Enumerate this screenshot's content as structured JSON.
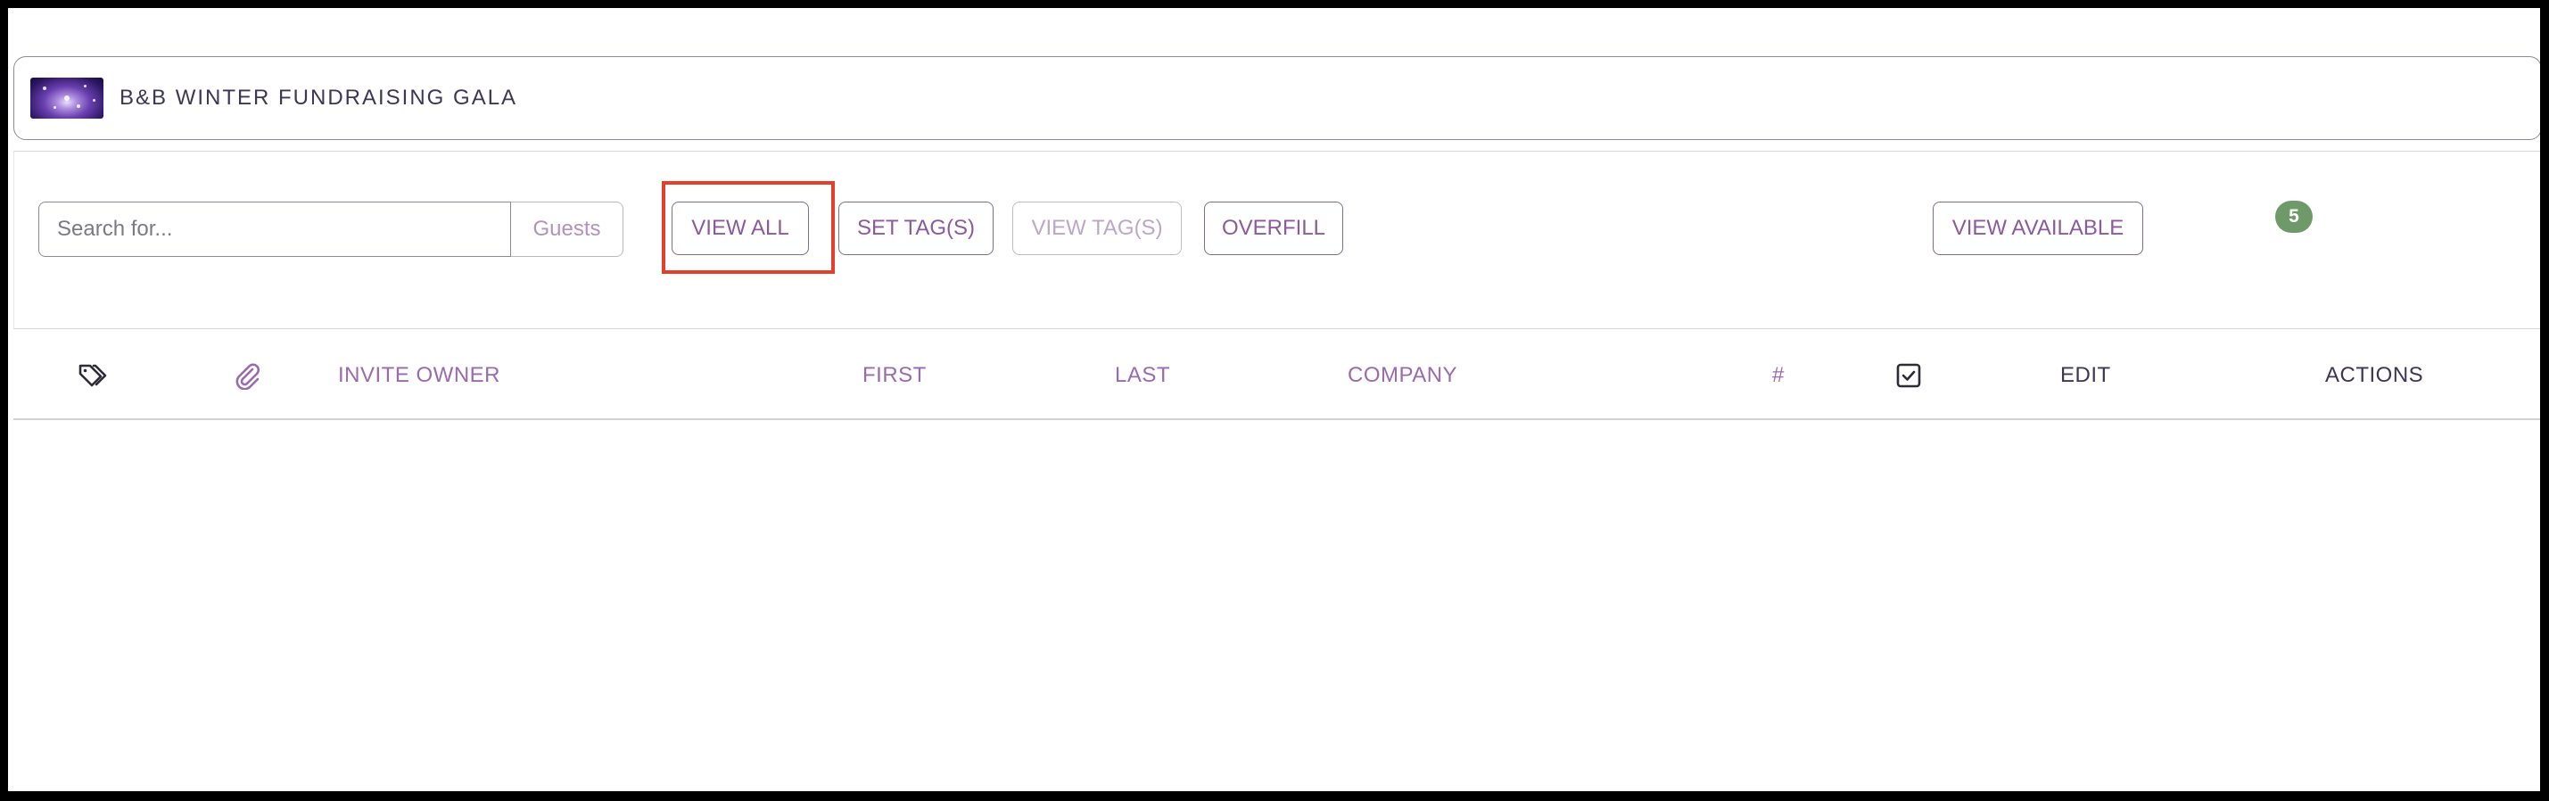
{
  "event": {
    "title": "B&B WINTER FUNDRAISING GALA",
    "thumbnail_icon": "event-image-icon"
  },
  "toolbar": {
    "search_placeholder": "Search for...",
    "search_scope": "Guests",
    "view_all": "VIEW ALL",
    "set_tags": "SET TAG(S)",
    "view_tags": "VIEW TAG(S)",
    "overfill": "OVERFILL",
    "view_available": "VIEW AVAILABLE",
    "available_count": "5"
  },
  "table": {
    "columns": {
      "tags_icon": "tag-icon",
      "attachment_icon": "paperclip-icon",
      "invite_owner": "INVITE OWNER",
      "first": "FIRST",
      "last": "LAST",
      "company": "COMPANY",
      "number": "#",
      "checked_icon": "checkbox-checked-icon",
      "edit": "EDIT",
      "actions": "ACTIONS"
    },
    "rows": []
  },
  "colors": {
    "accent": "#8a5a9c",
    "title_text": "#3f3554",
    "badge": "#6e9a6a",
    "highlight": "#e3402b"
  }
}
